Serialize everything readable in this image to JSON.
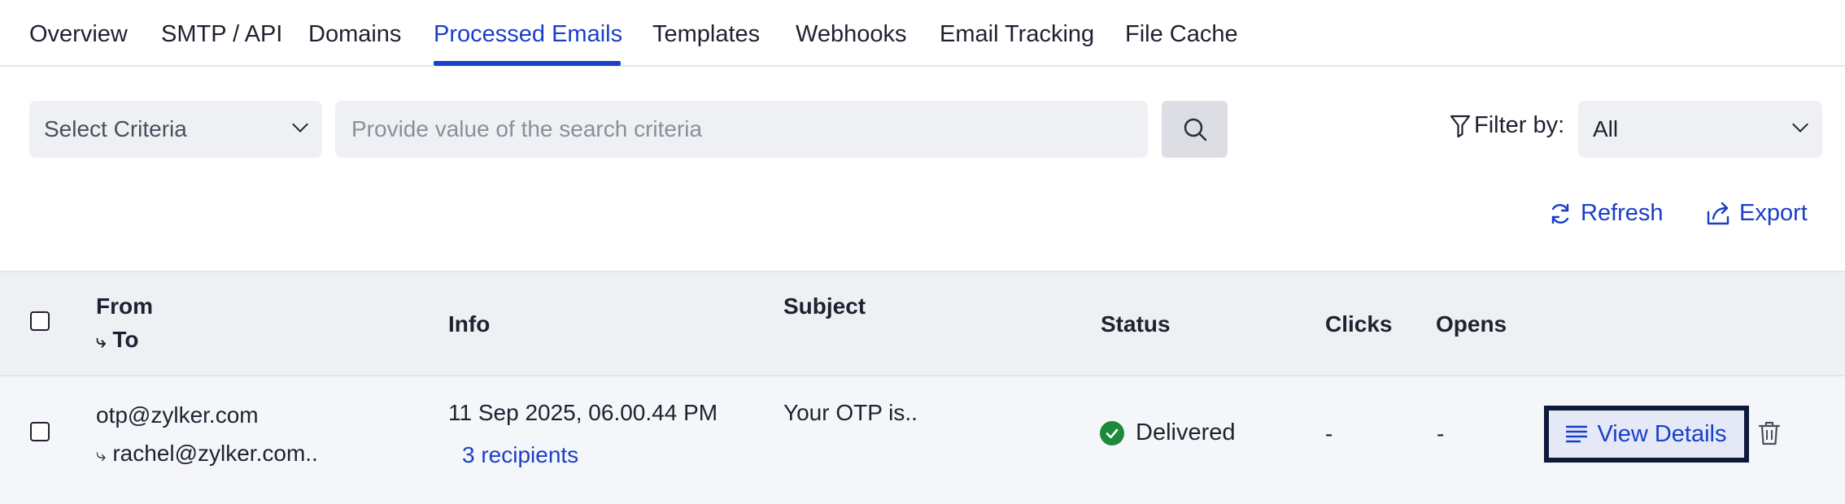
{
  "tabs": [
    {
      "label": "Overview"
    },
    {
      "label": "SMTP / API"
    },
    {
      "label": "Domains"
    },
    {
      "label": "Processed Emails",
      "active": true
    },
    {
      "label": "Templates"
    },
    {
      "label": "Webhooks"
    },
    {
      "label": "Email Tracking"
    },
    {
      "label": "File Cache"
    }
  ],
  "search": {
    "criteria_label": "Select Criteria",
    "placeholder": "Provide value of the search criteria"
  },
  "filter": {
    "label": "Filter by:",
    "value": "All"
  },
  "actions": {
    "refresh": "Refresh",
    "export": "Export"
  },
  "table": {
    "headers": {
      "from": "From",
      "to": "To",
      "info": "Info",
      "subject": "Subject",
      "status": "Status",
      "clicks": "Clicks",
      "opens": "Opens"
    },
    "rows": [
      {
        "from": "otp@zylker.com",
        "to": "rachel@zylker.com..",
        "date": "11 Sep 2025, 06.00.44 PM",
        "recipients": "3 recipients",
        "subject": "Your OTP is..",
        "status": "Delivered",
        "clicks": "-",
        "opens": "-",
        "view_label": "View Details"
      }
    ]
  },
  "colors": {
    "accent": "#1a3fc8",
    "status_delivered": "#1b8a3a",
    "header_bg": "#eef0f4"
  }
}
